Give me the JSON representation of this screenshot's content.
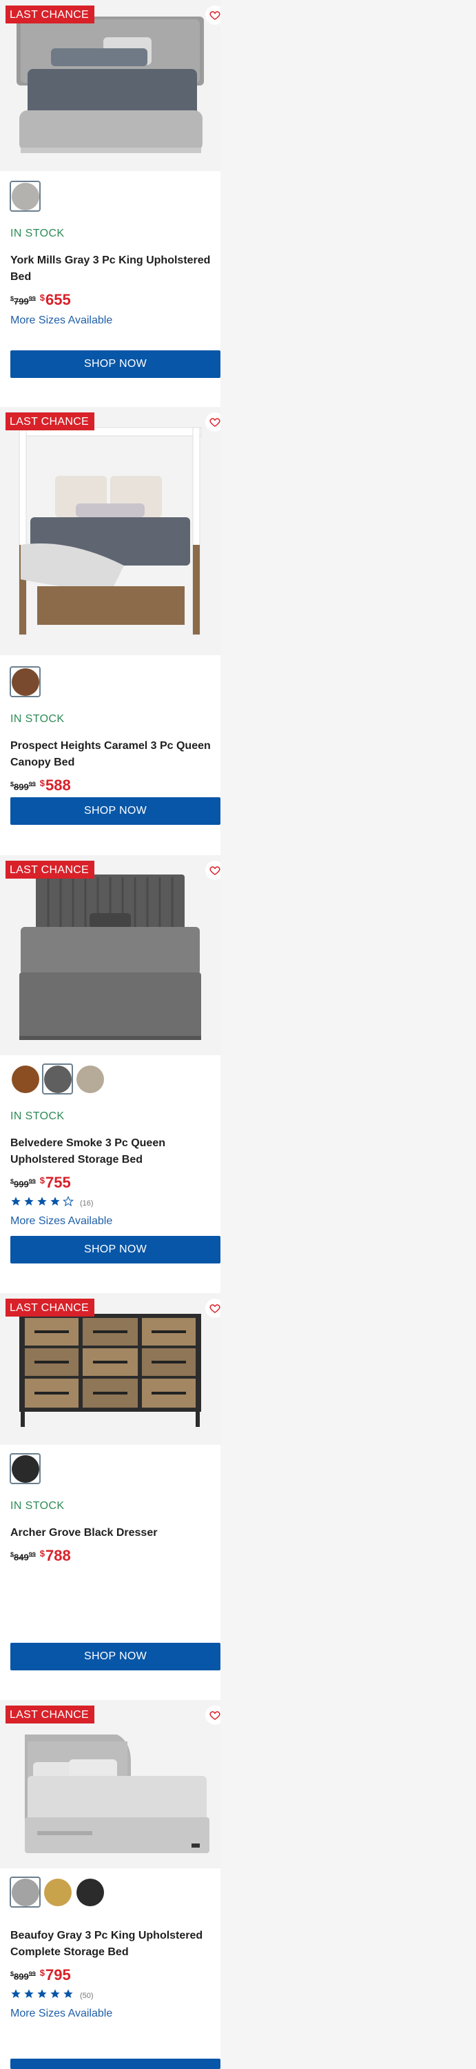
{
  "colors": {
    "accent_red": "#d82129",
    "stock_green": "#2e8b57",
    "button_blue": "#0756a8",
    "link_blue": "#1f5fa8"
  },
  "products": [
    {
      "badge": "LAST CHANCE",
      "stock": "IN STOCK",
      "title": "York Mills Gray 3 Pc King Upholstered Bed",
      "old_price": "799",
      "old_cents": "99",
      "new_price": "655",
      "more_sizes": "More Sizes Available",
      "button": "SHOP NOW",
      "swatches": [
        "gray"
      ]
    },
    {
      "badge": "LAST CHANCE",
      "stock": "IN STOCK",
      "title": "Prospect Heights Caramel 3 Pc Queen Canopy Bed",
      "old_price": "899",
      "old_cents": "99",
      "new_price": "588",
      "button": "SHOP NOW",
      "swatches": [
        "caramel"
      ]
    },
    {
      "badge": "LAST CHANCE",
      "stock": "IN STOCK",
      "title": "Belvedere Smoke 3 Pc Queen Upholstered Storage Bed",
      "old_price": "999",
      "old_cents": "99",
      "new_price": "755",
      "rating": 4,
      "rating_count": "(16)",
      "more_sizes": "More Sizes Available",
      "button": "SHOP NOW",
      "swatches": [
        "brown",
        "smoke",
        "taupe"
      ]
    },
    {
      "badge": "LAST CHANCE",
      "stock": "IN STOCK",
      "title": "Archer Grove Black Dresser",
      "old_price": "849",
      "old_cents": "99",
      "new_price": "788",
      "button": "SHOP NOW",
      "swatches": [
        "black"
      ]
    },
    {
      "badge": "LAST CHANCE",
      "title": "Beaufoy Gray 3 Pc King Upholstered Complete Storage Bed",
      "old_price": "899",
      "old_cents": "99",
      "new_price": "795",
      "rating": 5,
      "rating_count": "(50)",
      "more_sizes": "More Sizes Available",
      "swatches": [
        "gray",
        "gold",
        "black"
      ]
    }
  ]
}
